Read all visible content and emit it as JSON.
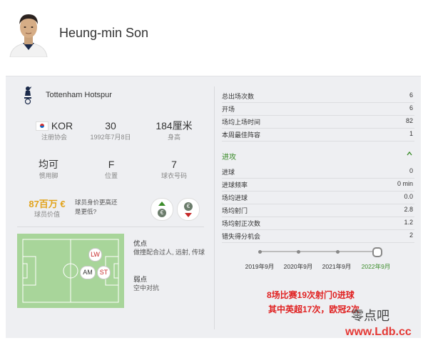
{
  "player": {
    "name": "Heung-min Son",
    "avatar_icon": "player-photo"
  },
  "club": {
    "name": "Tottenham Hotspur",
    "logo_icon": "spurs-cockerel-crest"
  },
  "info": {
    "country_code": "KOR",
    "country_label": "注册协会",
    "age": "30",
    "birthdate": "1992年7月8日",
    "height": "184厘米",
    "height_label": "身高",
    "foot": "均可",
    "foot_label": "惯用脚",
    "position": "F",
    "position_label": "位置",
    "shirt_number": "7",
    "shirt_label": "球衣号码"
  },
  "market_value": {
    "amount": "87百万 €",
    "label": "球员价值",
    "question": "球员身价更高还是更低?",
    "vote_up_icon": "euro-up-icon",
    "vote_down_icon": "euro-down-icon",
    "up_color": "#3b8c2a",
    "down_color": "#c62828"
  },
  "positions": {
    "lw": "LW",
    "am": "AM",
    "st": "ST"
  },
  "strengths": {
    "title": "优点",
    "text": "做撞配合过人, 远射, 传球"
  },
  "weaknesses": {
    "title": "弱点",
    "text": "空中对抗"
  },
  "summary": [
    {
      "label": "总出场次数",
      "value": "6"
    },
    {
      "label": "开场",
      "value": "6"
    },
    {
      "label": "场均上场时间",
      "value": "82"
    },
    {
      "label": "本周最佳阵容",
      "value": "1"
    }
  ],
  "attack": {
    "title": "进攻",
    "toggle_icon": "chevron-up-icon",
    "rows": [
      {
        "label": "进球",
        "value": "0"
      },
      {
        "label": "进球频率",
        "value": "0 min"
      },
      {
        "label": "场均进球",
        "value": "0.0"
      },
      {
        "label": "场均射门",
        "value": "2.8"
      },
      {
        "label": "场均射正次数",
        "value": "1.2"
      },
      {
        "label": "错失得分机会",
        "value": "2"
      }
    ]
  },
  "seasons": [
    "2019年9月",
    "2020年9月",
    "2021年9月",
    "2022年9月"
  ],
  "overlay": {
    "line1": "8场比赛19次射门0进球",
    "line2": "其中英超17次，欧冠2次"
  },
  "watermark": {
    "cn": "零点吧",
    "url": "www.Ldb.cc"
  }
}
